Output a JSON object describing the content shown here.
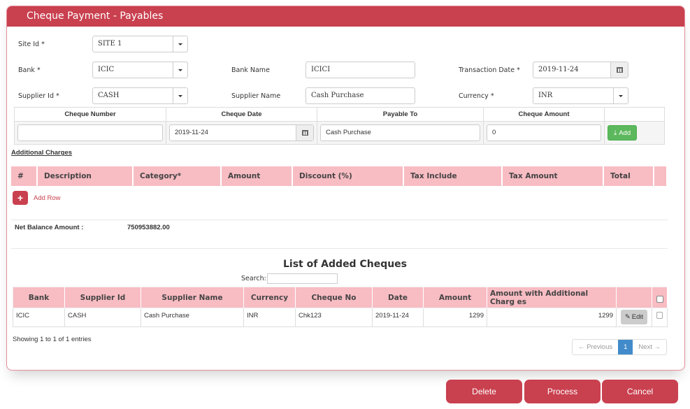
{
  "header": {
    "title": "Cheque Payment - Payables"
  },
  "form": {
    "site_id": {
      "label": "Site Id *",
      "value": "SITE 1"
    },
    "bank": {
      "label": "Bank *",
      "value": "ICIC"
    },
    "bank_name": {
      "label": "Bank Name",
      "value": "ICICI"
    },
    "transaction_date": {
      "label": "Transaction Date *",
      "value": "2019-11-24"
    },
    "supplier_id": {
      "label": "Supplier Id *",
      "value": "CASH"
    },
    "supplier_name": {
      "label": "Supplier Name",
      "value": "Cash Purchase"
    },
    "currency": {
      "label": "Currency *",
      "value": "INR"
    }
  },
  "cheque_entry": {
    "headers": [
      "Cheque Number",
      "Cheque Date",
      "Payable To",
      "Cheque Amount",
      ""
    ],
    "cheque_number": "",
    "cheque_date": "2019-11-24",
    "payable_to": "Cash Purchase",
    "cheque_amount": "0",
    "add_label": "Add"
  },
  "additional_charges": {
    "title": "Additional Charges",
    "headers": [
      "#",
      "Description",
      "Category*",
      "Amount",
      "Discount (%)",
      "Tax Include",
      "Tax Amount",
      "Total",
      ""
    ],
    "add_row_label": "Add Row"
  },
  "net_balance": {
    "label": "Net Balance Amount :",
    "value": "750953882.00"
  },
  "cheque_list": {
    "title": "List of Added Cheques",
    "search_label": "Search:",
    "search_value": "",
    "headers": [
      "Bank",
      "Supplier Id",
      "Supplier Name",
      "Currency",
      "Cheque No",
      "Date",
      "Amount",
      "Amount with Additional Charg es",
      ""
    ],
    "rows": [
      {
        "bank": "ICIC",
        "supplier_id": "CASH",
        "supplier_name": "Cash Purchase",
        "currency": "INR",
        "cheque_no": "Chk123",
        "date": "2019-11-24",
        "amount": "1299",
        "amount_with_charges": "1299",
        "edit_label": "Edit",
        "checked": false
      }
    ],
    "showing": "Showing 1 to 1 of 1 entries",
    "pagination": {
      "previous": "← Previous",
      "current": "1",
      "next": "Next →"
    }
  },
  "actions": {
    "delete": "Delete",
    "process": "Process",
    "cancel": "Cancel"
  },
  "colors": {
    "brand": "#c9404f",
    "table_header": "#f8bcc3",
    "add_button": "#5cb85c",
    "page_active": "#428bca"
  }
}
